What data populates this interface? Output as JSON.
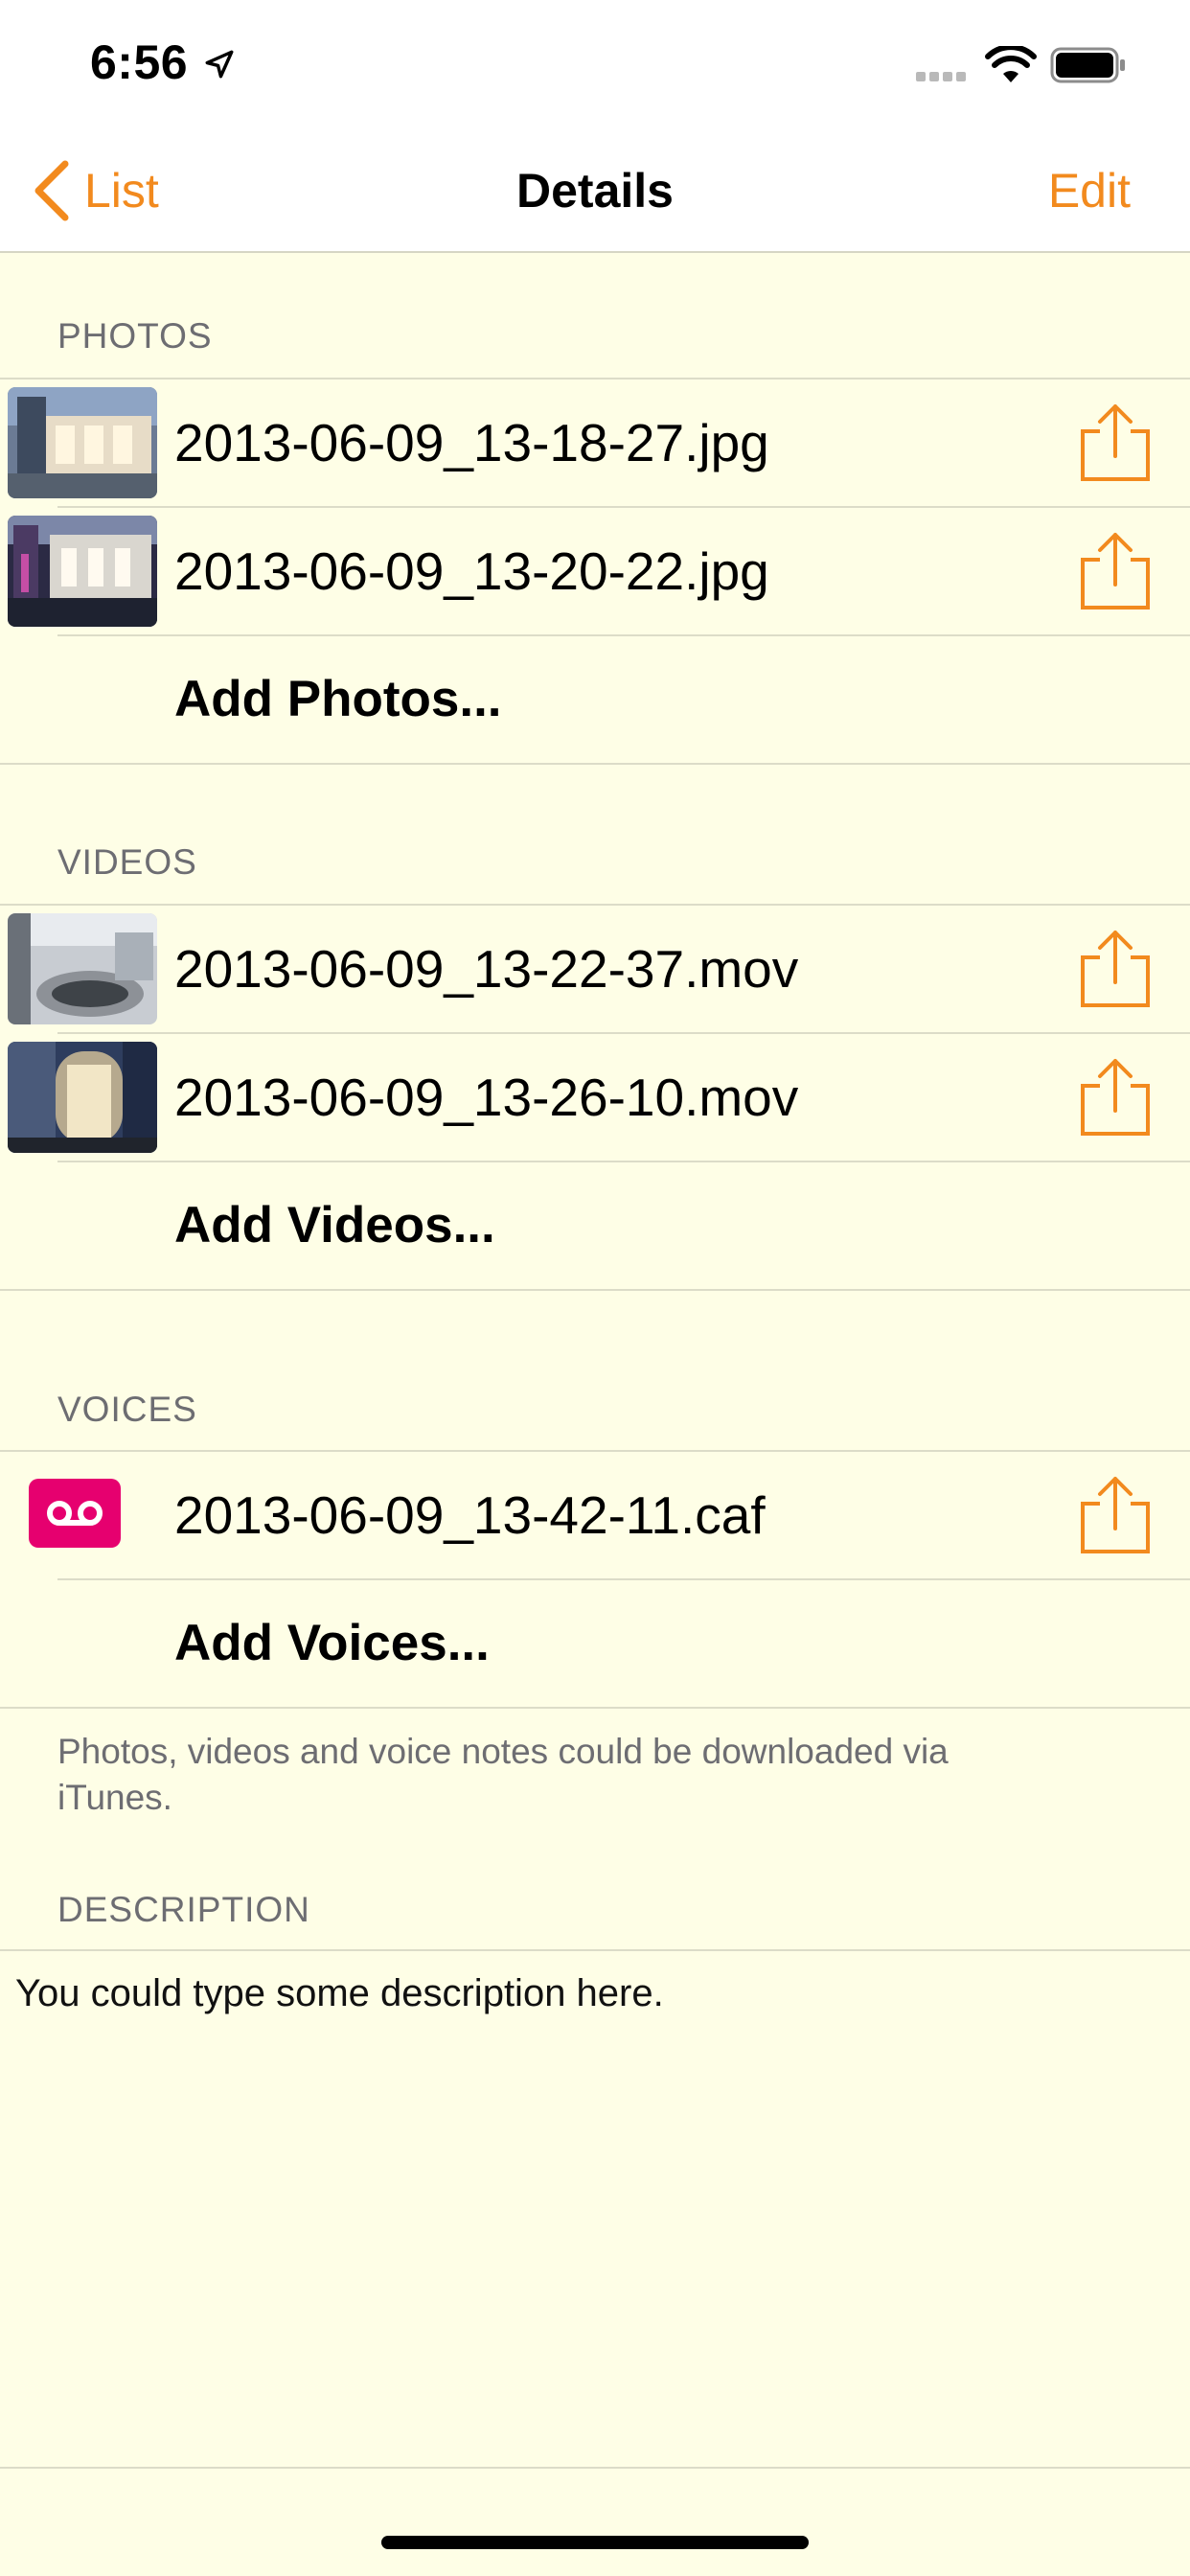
{
  "status": {
    "time": "6:56"
  },
  "nav": {
    "back_label": "List",
    "title": "Details",
    "edit_label": "Edit"
  },
  "photos": {
    "header": "PHOTOS",
    "items": [
      {
        "name": "2013-06-09_13-18-27.jpg"
      },
      {
        "name": "2013-06-09_13-20-22.jpg"
      }
    ],
    "add_label": "Add Photos..."
  },
  "videos": {
    "header": "VIDEOS",
    "items": [
      {
        "name": "2013-06-09_13-22-37.mov"
      },
      {
        "name": "2013-06-09_13-26-10.mov"
      }
    ],
    "add_label": "Add Videos..."
  },
  "voices": {
    "header": "VOICES",
    "items": [
      {
        "name": "2013-06-09_13-42-11.caf"
      }
    ],
    "add_label": "Add Voices...",
    "footer": "Photos, videos and voice notes could be downloaded via iTunes."
  },
  "description": {
    "header": "DESCRIPTION",
    "text": "You could type some description here."
  },
  "colors": {
    "accent": "#f28a1e",
    "background": "#fefee6",
    "voice_badge": "#e6006f"
  }
}
